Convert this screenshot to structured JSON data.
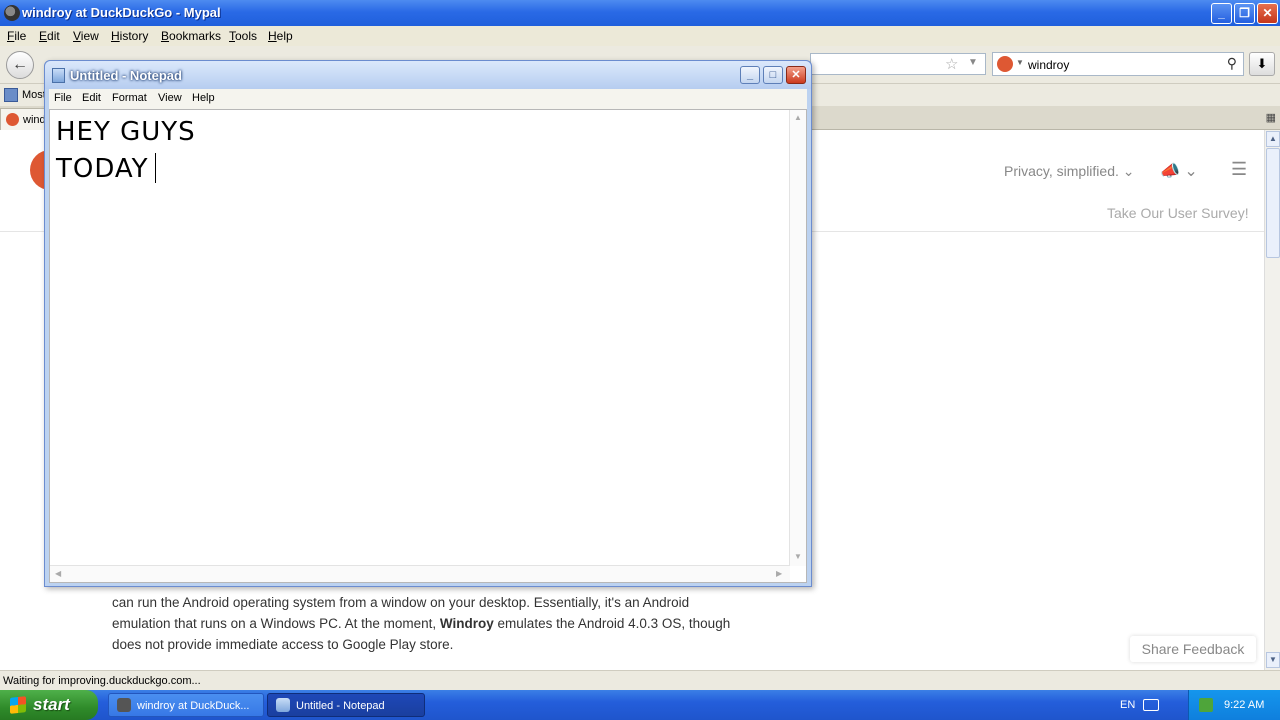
{
  "browser": {
    "title": "windroy at DuckDuckGo - Mypal",
    "menu": [
      "File",
      "Edit",
      "View",
      "History",
      "Bookmarks",
      "Tools",
      "Help"
    ],
    "search_query": "windroy",
    "bookmark_label": "Most",
    "tab_label": "wind",
    "status": "Waiting for improving.duckduckgo.com..."
  },
  "page": {
    "privacy": "Privacy, simplified.",
    "survey": "Take Our User Survey!",
    "snippet_line1": "can run the Android operating system from a window on your desktop. Essentially, it's an Android",
    "snippet_line2_a": "emulation that runs on a Windows PC. At the moment, ",
    "snippet_line2_bold": "Windroy",
    "snippet_line2_b": " emulates the Android 4.0.3 OS, though",
    "snippet_line3": "does not provide immediate access to Google Play store.",
    "share_feedback": "Share Feedback"
  },
  "notepad": {
    "title": "Untitled - Notepad",
    "menu": [
      "File",
      "Edit",
      "Format",
      "View",
      "Help"
    ],
    "line1": "HEY GUYS",
    "line2": "TODAY"
  },
  "taskbar": {
    "start": "start",
    "tasks": [
      "windroy at DuckDuck...",
      "Untitled - Notepad"
    ],
    "lang": "EN",
    "clock": "9:22 AM"
  },
  "icons": {
    "app": "mypal-raccoon-icon",
    "search_engine": "duckduckgo-icon",
    "notepad": "notepad-icon",
    "start_flag": "windows-flag-icon"
  }
}
